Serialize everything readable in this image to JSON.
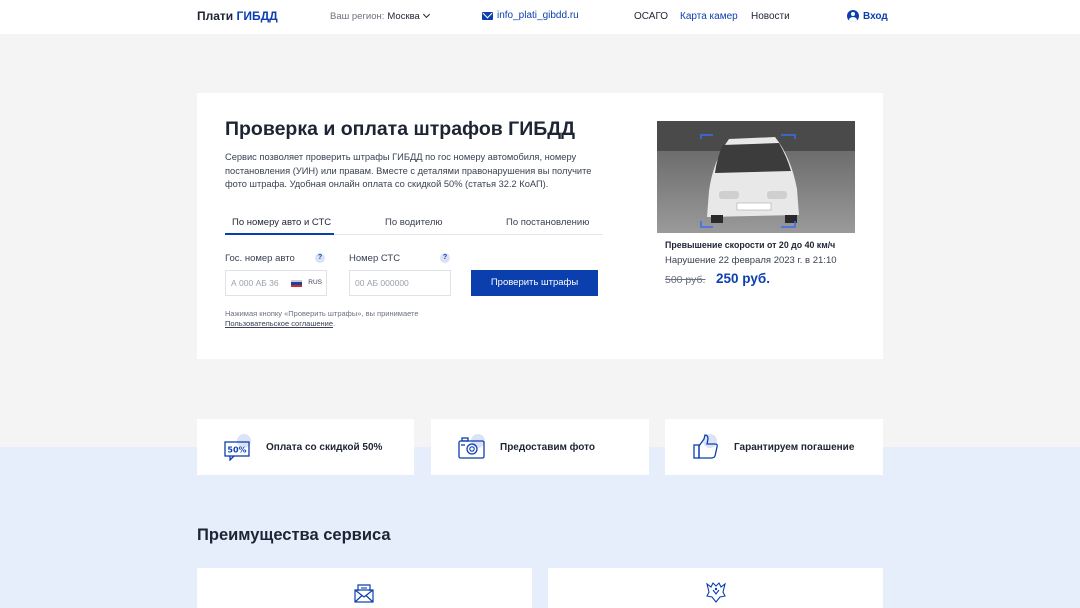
{
  "header": {
    "logo_main": "Плати",
    "logo_accent": "ГИБДД",
    "region_label": "Ваш регион:",
    "region_city": "Москва",
    "email": "info_plati_gibdd.ru",
    "nav": [
      "ОСАГО",
      "Карта камер",
      "Новости"
    ],
    "login": "Вход"
  },
  "hero": {
    "title": "Проверка и оплата штрафов ГИБДД",
    "description": "Сервис позволяет проверить штрафы ГИБДД по гос номеру автомобиля, номеру постановления (УИН) или правам. Вместе с деталями правонарушения вы получите фото штрафа. Удобная онлайн оплата со скидкой 50% (статья 32.2 КоАП).",
    "tabs": [
      "По номеру авто и СТС",
      "По водителю",
      "По постановлению"
    ],
    "plate_label": "Гос. номер авто",
    "plate_placeholder": "А 000 АБ 36",
    "plate_region": "RUS",
    "sts_label": "Номер СТС",
    "sts_placeholder": "00 АБ 000000",
    "qmark": "?",
    "check_button": "Проверить штрафы",
    "note_text": "Нажимая кнопку «Проверить штрафы», вы принимаете ",
    "note_link": "Пользовательское соглашение",
    "note_end": "."
  },
  "fine_example": {
    "violation": "Превышение скорости от 20 до 40 км/ч",
    "date": "Нарушение 22 февраля 2023 г. в 21:10",
    "old_price": "500 руб.",
    "new_price": "250 руб."
  },
  "features": [
    {
      "icon": "discount-50-icon",
      "text": "Оплата со скидкой 50%"
    },
    {
      "icon": "camera-icon",
      "text": "Предоставим фото"
    },
    {
      "icon": "thumbs-up-icon",
      "text": "Гарантируем погашение"
    }
  ],
  "advantages": {
    "title": "Преимущества сервиса",
    "icons": [
      "envelope-icon",
      "emblem-icon"
    ]
  },
  "colors": {
    "accent": "#0c3fae",
    "background": "#f4f4f5",
    "band": "#e6edfb"
  }
}
